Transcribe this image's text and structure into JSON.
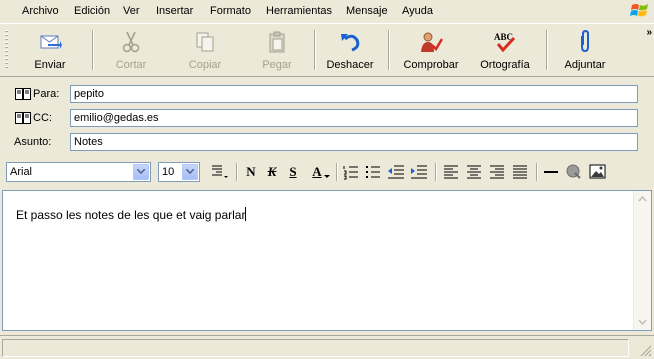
{
  "menu": [
    "Archivo",
    "Edición",
    "Ver",
    "Insertar",
    "Formato",
    "Herramientas",
    "Mensaje",
    "Ayuda"
  ],
  "toolbar": {
    "enviar": "Enviar",
    "cortar": "Cortar",
    "copiar": "Copiar",
    "pegar": "Pegar",
    "deshacer": "Deshacer",
    "comprobar": "Comprobar",
    "ortografia": "Ortografía",
    "adjuntar": "Adjuntar",
    "abc": "ABC",
    "more": "»"
  },
  "header": {
    "para_label": "Para:",
    "para_value": "pepito",
    "cc_label": "CC:",
    "cc_value": "emilio@gedas.es",
    "asunto_label": "Asunto:",
    "asunto_value": "Notes"
  },
  "format": {
    "font": "Arial",
    "size": "10",
    "bold": "N",
    "italic": "K",
    "underline": "S",
    "color": "A"
  },
  "body": {
    "text": "Et passo les notes de les que et vaig parlar"
  },
  "colors": {
    "chrome": "#ece9d8",
    "accent": "#1c5fd0",
    "disabled": "#a5a18e"
  }
}
